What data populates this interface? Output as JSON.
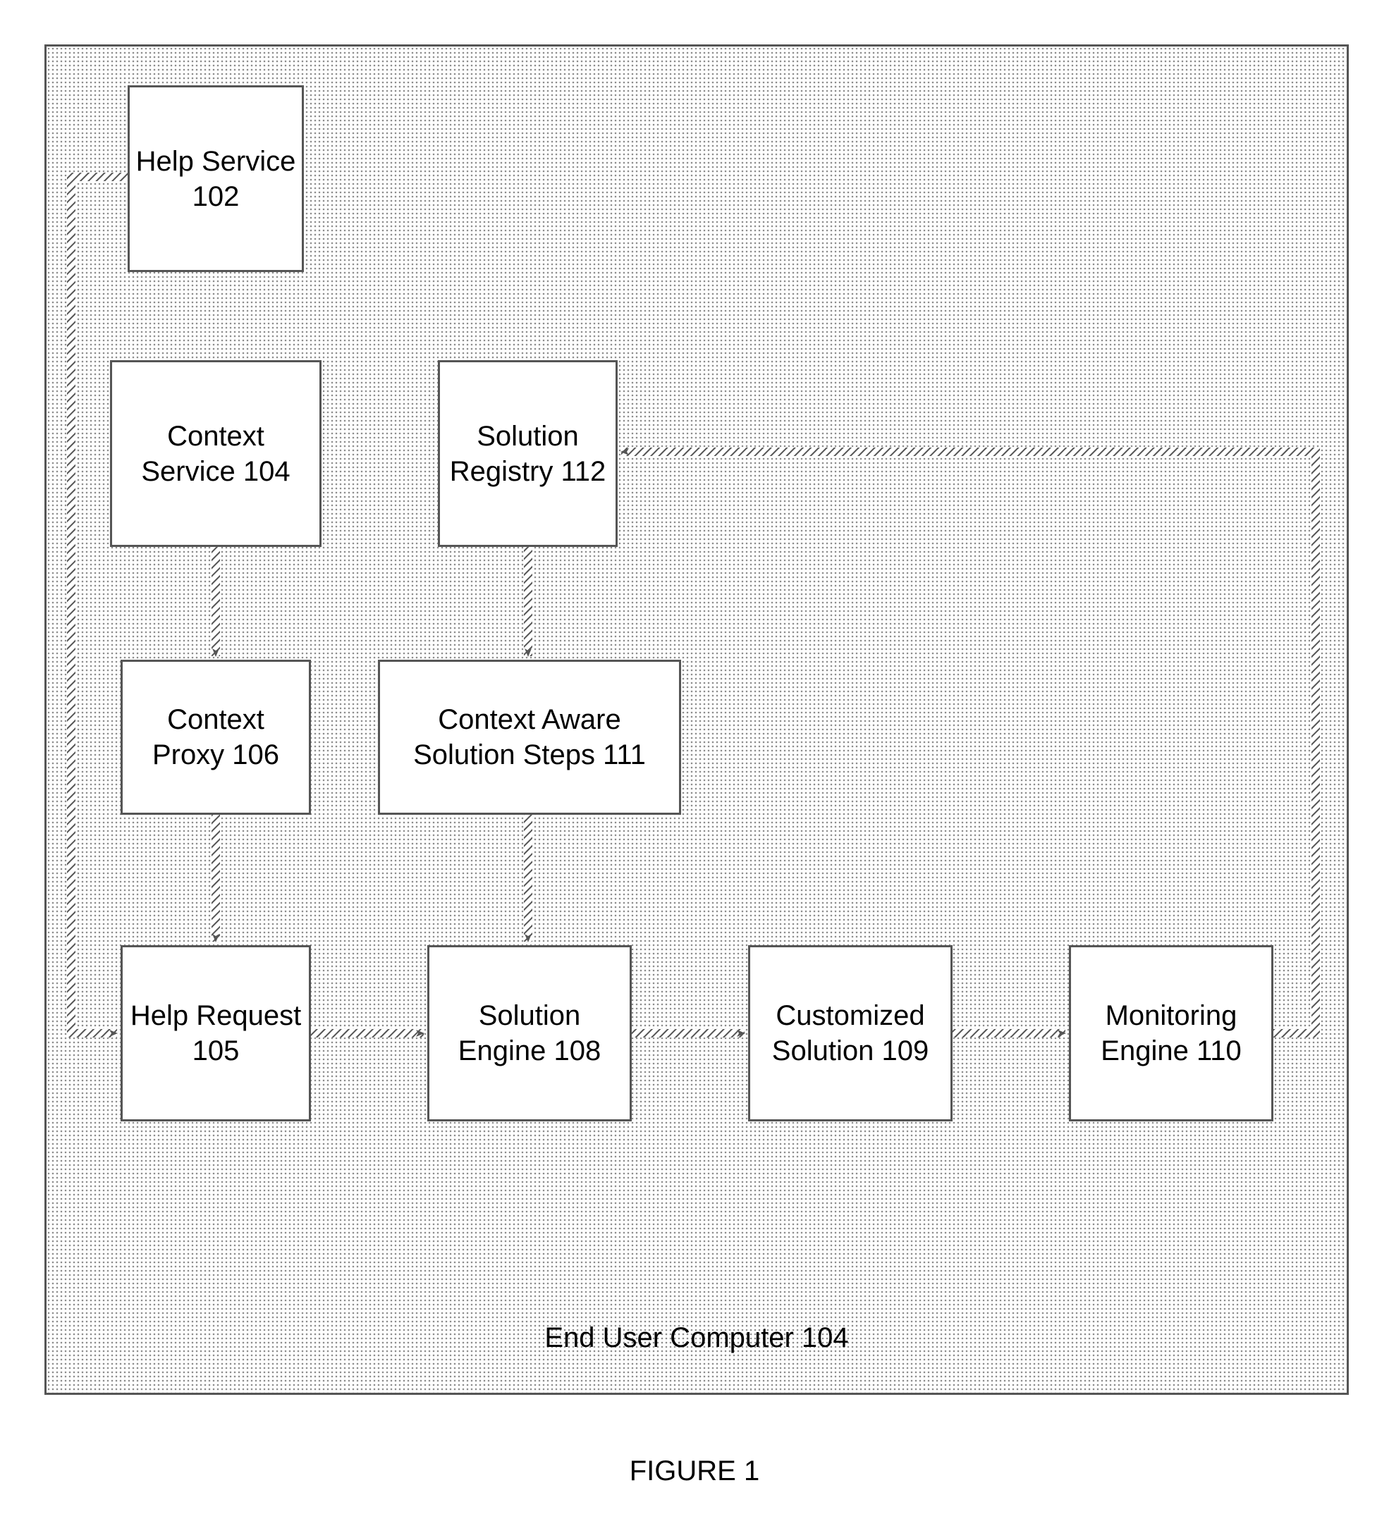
{
  "diagram": {
    "container_label": "End User Computer 104",
    "figure_label": "FIGURE 1",
    "boxes": {
      "help_service": "Help Service 102",
      "context_service": "Context Service 104",
      "solution_registry": "Solution Registry 112",
      "context_proxy": "Context Proxy 106",
      "context_aware": "Context Aware Solution Steps 111",
      "help_request": "Help Request 105",
      "solution_engine": "Solution Engine 108",
      "customized_sol": "Customized Solution 109",
      "monitoring_eng": "Monitoring Engine 110"
    },
    "edges": [
      {
        "from": "help_service",
        "to": "help_request",
        "path": "left-down"
      },
      {
        "from": "context_service",
        "to": "context_proxy",
        "path": "down"
      },
      {
        "from": "context_proxy",
        "to": "help_request",
        "path": "down"
      },
      {
        "from": "solution_registry",
        "to": "context_aware",
        "path": "down"
      },
      {
        "from": "context_aware",
        "to": "solution_engine",
        "path": "down"
      },
      {
        "from": "help_request",
        "to": "solution_engine",
        "path": "right"
      },
      {
        "from": "solution_engine",
        "to": "customized_sol",
        "path": "right"
      },
      {
        "from": "customized_sol",
        "to": "monitoring_eng",
        "path": "right"
      },
      {
        "from": "monitoring_eng",
        "to": "solution_registry",
        "path": "up-left"
      }
    ]
  }
}
